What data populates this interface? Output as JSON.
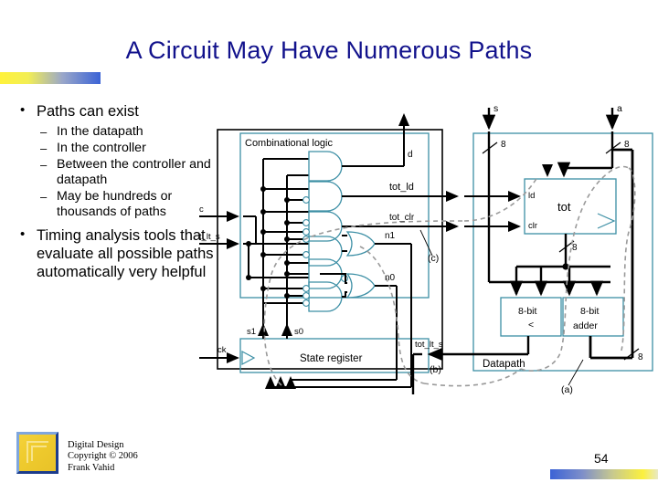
{
  "slide": {
    "title": "A Circuit May Have Numerous Paths",
    "page_number": "54",
    "accent_blue": "#12128C",
    "box_border": "#3C8FA5"
  },
  "bullets": [
    {
      "level": 1,
      "marker": "•",
      "text": "Paths can exist"
    },
    {
      "level": 2,
      "marker": "–",
      "text": "In the datapath"
    },
    {
      "level": 2,
      "marker": "–",
      "text": "In the controller"
    },
    {
      "level": 2,
      "marker": "–",
      "text": "Between the controller and datapath"
    },
    {
      "level": 2,
      "marker": "–",
      "text": "May be hundreds or thousands of paths"
    },
    {
      "level": 1,
      "marker": "•",
      "text": "Timing analysis tools that evaluate all possible paths automatically very helpful"
    }
  ],
  "footer": {
    "line1": "Digital Design",
    "line2": "Copyright © 2006",
    "line3": "Frank Vahid"
  },
  "figure": {
    "controller": {
      "comb_logic_label": "Combinational logic",
      "state_register_label": "State register",
      "inputs": [
        {
          "name": "c"
        },
        {
          "name": "tot_lt_s"
        },
        {
          "name": "ck"
        }
      ],
      "state_bits": [
        {
          "name": "s1"
        },
        {
          "name": "s0"
        }
      ],
      "outputs": [
        {
          "name": "d"
        },
        {
          "name": "tot_ld"
        },
        {
          "name": "tot_clr"
        },
        {
          "name": "n1"
        },
        {
          "name": "n0"
        }
      ]
    },
    "datapath": {
      "label": "Datapath",
      "inputs": [
        {
          "name": "s",
          "width": "8"
        },
        {
          "name": "a",
          "width": "8"
        }
      ],
      "register": {
        "name": "tot",
        "ports": [
          "ld",
          "clr"
        ],
        "out_width": "8"
      },
      "blocks": [
        {
          "line1": "8-bit",
          "line2": "<"
        },
        {
          "line1": "8-bit",
          "line2": "adder"
        }
      ],
      "out_signal": "tot_lt_s",
      "adder_out_width": "8"
    },
    "annotations": [
      {
        "name": "a",
        "label": "(a)"
      },
      {
        "name": "b",
        "label": "(b)"
      },
      {
        "name": "c",
        "label": "(c)"
      }
    ]
  }
}
